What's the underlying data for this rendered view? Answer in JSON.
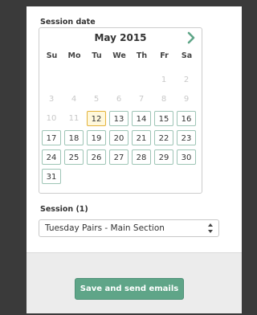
{
  "form": {
    "session_date_label": "Session date",
    "session_label": "Session (1)",
    "session_selected": "Tuesday Pairs - Main Section",
    "save_label": "Save and send emails"
  },
  "calendar": {
    "month_title": "May 2015",
    "weekdays": [
      "Su",
      "Mo",
      "Tu",
      "We",
      "Th",
      "Fr",
      "Sa"
    ],
    "weeks": [
      [
        {
          "d": ""
        },
        {
          "d": ""
        },
        {
          "d": ""
        },
        {
          "d": ""
        },
        {
          "d": ""
        },
        {
          "d": "1",
          "s": "inactive"
        },
        {
          "d": "2",
          "s": "inactive"
        }
      ],
      [
        {
          "d": "3",
          "s": "inactive"
        },
        {
          "d": "4",
          "s": "inactive"
        },
        {
          "d": "5",
          "s": "inactive"
        },
        {
          "d": "6",
          "s": "inactive"
        },
        {
          "d": "7",
          "s": "inactive"
        },
        {
          "d": "8",
          "s": "inactive"
        },
        {
          "d": "9",
          "s": "inactive"
        }
      ],
      [
        {
          "d": "10",
          "s": "inactive"
        },
        {
          "d": "11",
          "s": "inactive"
        },
        {
          "d": "12",
          "s": "selected"
        },
        {
          "d": "13",
          "s": "active"
        },
        {
          "d": "14",
          "s": "active"
        },
        {
          "d": "15",
          "s": "active"
        },
        {
          "d": "16",
          "s": "active"
        }
      ],
      [
        {
          "d": "17",
          "s": "active"
        },
        {
          "d": "18",
          "s": "active"
        },
        {
          "d": "19",
          "s": "active"
        },
        {
          "d": "20",
          "s": "active"
        },
        {
          "d": "21",
          "s": "active"
        },
        {
          "d": "22",
          "s": "active"
        },
        {
          "d": "23",
          "s": "active"
        }
      ],
      [
        {
          "d": "24",
          "s": "active"
        },
        {
          "d": "25",
          "s": "active"
        },
        {
          "d": "26",
          "s": "active"
        },
        {
          "d": "27",
          "s": "active"
        },
        {
          "d": "28",
          "s": "active"
        },
        {
          "d": "29",
          "s": "active"
        },
        {
          "d": "30",
          "s": "active"
        }
      ],
      [
        {
          "d": "31",
          "s": "active"
        },
        {
          "d": ""
        },
        {
          "d": ""
        },
        {
          "d": ""
        },
        {
          "d": ""
        },
        {
          "d": ""
        },
        {
          "d": ""
        }
      ]
    ]
  },
  "icons": {
    "next": "chevron-right-icon",
    "select": "select-arrows-icon"
  },
  "colors": {
    "accent": "#5fa588",
    "selected_day": "#e3b33b",
    "day_border": "#9ec5b6"
  }
}
